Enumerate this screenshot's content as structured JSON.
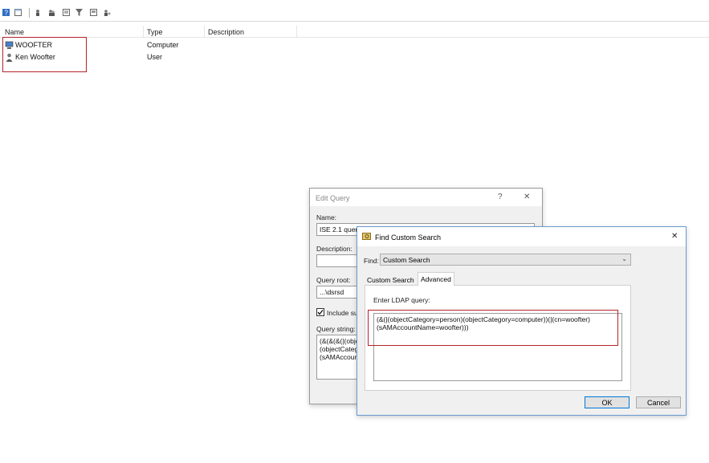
{
  "toolbar": {
    "icons": [
      "help-icon",
      "view-icon",
      "find-users-icon",
      "find-group-icon",
      "query-icon",
      "filter-icon",
      "saved-query-icon",
      "users-icon"
    ]
  },
  "list": {
    "columns": [
      "Name",
      "Type",
      "Description"
    ],
    "rows": [
      {
        "name": "WOOFTER",
        "type": "Computer",
        "icon": "computer-icon"
      },
      {
        "name": "Ken Woofter",
        "type": "User",
        "icon": "user-icon"
      }
    ]
  },
  "edit_query": {
    "title": "Edit Query",
    "help": "?",
    "close": "✕",
    "name_label": "Name:",
    "name_value": "ISE 2.1 query",
    "description_label": "Description:",
    "description_value": "",
    "query_root_label": "Query root:",
    "query_root_value": "...\\dsrsd",
    "include_subcontainers_label": "Include su",
    "include_subcontainers_checked": true,
    "query_string_label": "Query string:",
    "query_string_lines": [
      "(&(&(&(|(object",
      "(objectCatego",
      "(sAMAccoun"
    ]
  },
  "find_custom": {
    "title": "Find Custom Search",
    "close": "✕",
    "find_label": "Find:",
    "find_value": "Custom Search",
    "tabs": [
      "Custom Search",
      "Advanced"
    ],
    "active_tab": "Advanced",
    "ldap_label": "Enter LDAP query:",
    "ldap_lines": [
      "(&(|(objectCategory=person)(objectCategory=computer))(|(cn=woofter)",
      "(sAMAccountName=woofter)))"
    ],
    "ok_label": "OK",
    "cancel_label": "Cancel"
  },
  "colors": {
    "highlight": "#b4232a",
    "focus_border": "#0078d7"
  }
}
